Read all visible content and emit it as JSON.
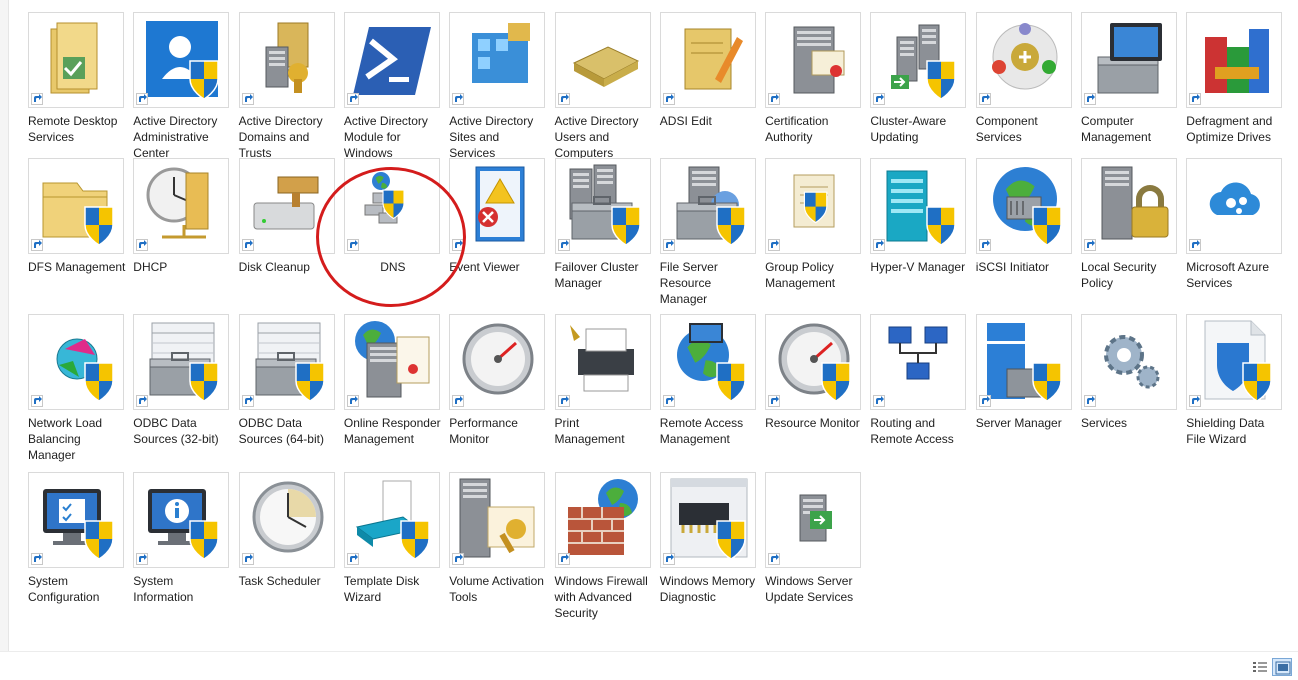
{
  "items": [
    {
      "label": "Remote Desktop Services",
      "icon": "remote-desktop-services-icon"
    },
    {
      "label": "Active Directory Administrative Center",
      "icon": "ad-admin-center-icon"
    },
    {
      "label": "Active Directory Domains and Trusts",
      "icon": "ad-domains-trusts-icon"
    },
    {
      "label": "Active Directory Module for Windows PowerShell",
      "icon": "powershell-icon"
    },
    {
      "label": "Active Directory Sites and Services",
      "icon": "ad-sites-services-icon"
    },
    {
      "label": "Active Directory Users and Computers",
      "icon": "ad-users-computers-icon"
    },
    {
      "label": "ADSI Edit",
      "icon": "adsi-edit-icon"
    },
    {
      "label": "Certification Authority",
      "icon": "certification-authority-icon"
    },
    {
      "label": "Cluster-Aware Updating",
      "icon": "cluster-aware-updating-icon"
    },
    {
      "label": "Component Services",
      "icon": "component-services-icon"
    },
    {
      "label": "Computer Management",
      "icon": "computer-management-icon"
    },
    {
      "label": "Defragment and Optimize Drives",
      "icon": "defragment-icon"
    },
    {
      "label": "DFS Management",
      "icon": "dfs-management-icon"
    },
    {
      "label": "DHCP",
      "icon": "dhcp-icon"
    },
    {
      "label": "Disk Cleanup",
      "icon": "disk-cleanup-icon"
    },
    {
      "label": "DNS",
      "icon": "dns-icon"
    },
    {
      "label": "Event Viewer",
      "icon": "event-viewer-icon"
    },
    {
      "label": "Failover Cluster Manager",
      "icon": "failover-cluster-icon"
    },
    {
      "label": "File Server Resource Manager",
      "icon": "file-server-resource-icon"
    },
    {
      "label": "Group Policy Management",
      "icon": "group-policy-icon"
    },
    {
      "label": "Hyper-V Manager",
      "icon": "hyper-v-icon"
    },
    {
      "label": "iSCSI Initiator",
      "icon": "iscsi-icon"
    },
    {
      "label": "Local Security Policy",
      "icon": "local-security-policy-icon"
    },
    {
      "label": "Microsoft Azure Services",
      "icon": "azure-services-icon"
    },
    {
      "label": "Network Load Balancing Manager",
      "icon": "network-load-balancing-icon"
    },
    {
      "label": "ODBC Data Sources (32-bit)",
      "icon": "odbc-32-icon"
    },
    {
      "label": "ODBC Data Sources (64-bit)",
      "icon": "odbc-64-icon"
    },
    {
      "label": "Online Responder Management",
      "icon": "online-responder-icon"
    },
    {
      "label": "Performance Monitor",
      "icon": "performance-monitor-icon"
    },
    {
      "label": "Print Management",
      "icon": "print-management-icon"
    },
    {
      "label": "Remote Access Management",
      "icon": "remote-access-icon"
    },
    {
      "label": "Resource Monitor",
      "icon": "resource-monitor-icon"
    },
    {
      "label": "Routing and Remote Access",
      "icon": "routing-remote-access-icon"
    },
    {
      "label": "Server Manager",
      "icon": "server-manager-icon"
    },
    {
      "label": "Services",
      "icon": "services-gear-icon"
    },
    {
      "label": "Shielding Data File Wizard",
      "icon": "shielding-data-icon"
    },
    {
      "label": "System Configuration",
      "icon": "system-configuration-icon"
    },
    {
      "label": "System Information",
      "icon": "system-information-icon"
    },
    {
      "label": "Task Scheduler",
      "icon": "task-scheduler-icon"
    },
    {
      "label": "Template Disk Wizard",
      "icon": "template-disk-icon"
    },
    {
      "label": "Volume Activation Tools",
      "icon": "volume-activation-icon"
    },
    {
      "label": "Windows Firewall with Advanced Security",
      "icon": "windows-firewall-icon"
    },
    {
      "label": "Windows Memory Diagnostic",
      "icon": "memory-diagnostic-icon"
    },
    {
      "label": "Windows Server Update Services",
      "icon": "wsus-icon"
    }
  ],
  "selected_label": "DNS",
  "colors": {
    "highlight_ring": "#d41c1c",
    "shield_blue": "#1f6fc4",
    "shield_yellow": "#f5c400"
  }
}
